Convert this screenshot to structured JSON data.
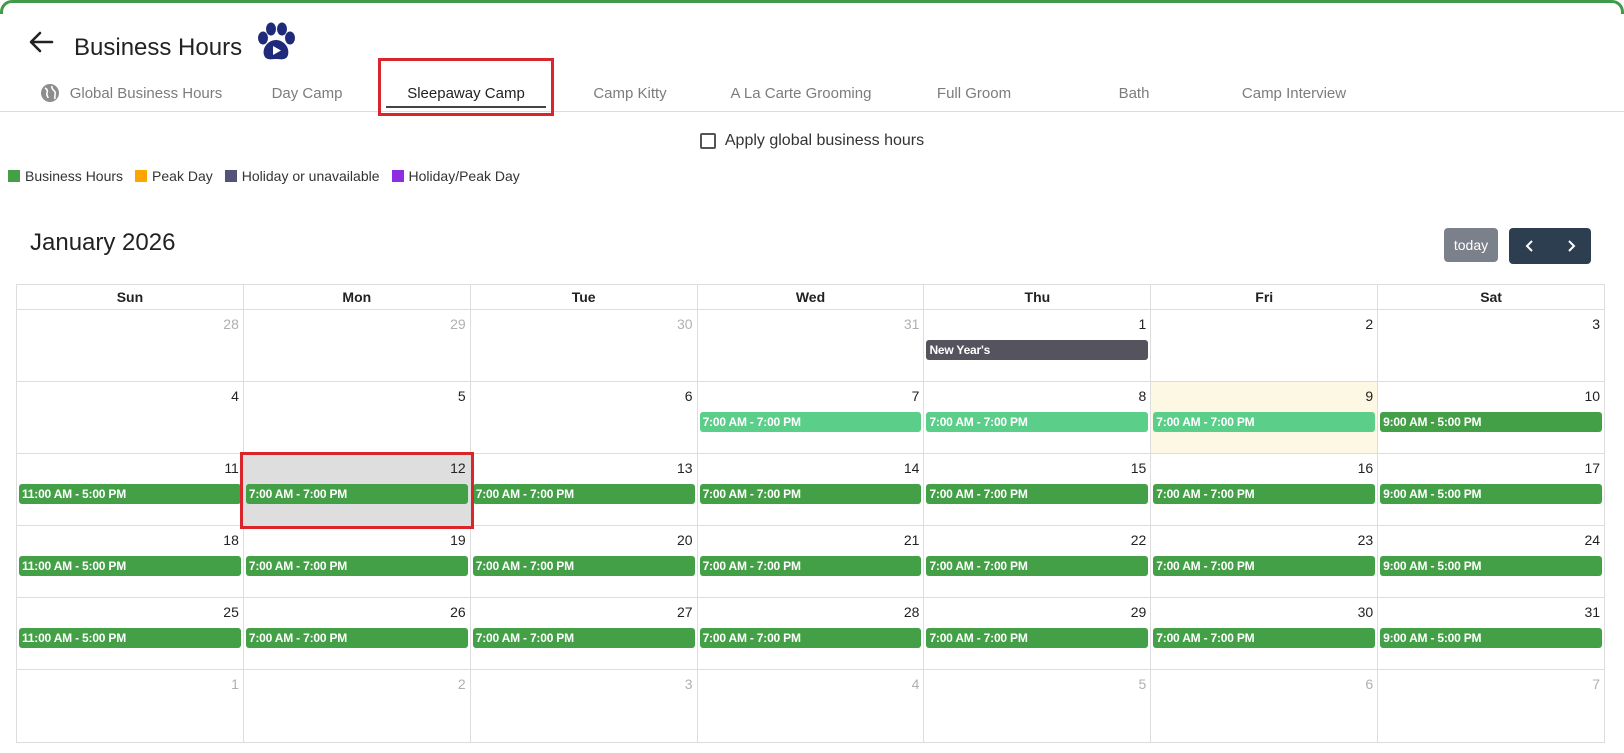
{
  "header": {
    "title": "Business Hours",
    "back_icon": "arrow-left-icon",
    "logo_icon": "paw-play-icon"
  },
  "tabs": [
    {
      "label": "Global Business Hours",
      "icon": "globe-icon"
    },
    {
      "label": "Day Camp"
    },
    {
      "label": "Sleepaway Camp",
      "active": true
    },
    {
      "label": "Camp Kitty"
    },
    {
      "label": "A La Carte Grooming"
    },
    {
      "label": "Full Groom"
    },
    {
      "label": "Bath"
    },
    {
      "label": "Camp Interview"
    }
  ],
  "apply_global": {
    "label": "Apply global business hours",
    "checked": false
  },
  "legend": [
    {
      "label": "Business Hours",
      "color": "#43a047"
    },
    {
      "label": "Peak Day",
      "color": "#ffa500"
    },
    {
      "label": "Holiday or unavailable",
      "color": "#52527a"
    },
    {
      "label": "Holiday/Peak Day",
      "color": "#8e2de2"
    }
  ],
  "calendar": {
    "title": "January 2026",
    "today_label": "today",
    "weekdays": [
      "Sun",
      "Mon",
      "Tue",
      "Wed",
      "Thu",
      "Fri",
      "Sat"
    ],
    "colors": {
      "business": "#43a047",
      "light": "#5bce8a",
      "holiday": "#55535e"
    },
    "weeks": [
      [
        {
          "day": "28",
          "other": true
        },
        {
          "day": "29",
          "other": true
        },
        {
          "day": "30",
          "other": true
        },
        {
          "day": "31",
          "other": true
        },
        {
          "day": "1",
          "event": "New Year's",
          "style": "holiday"
        },
        {
          "day": "2"
        },
        {
          "day": "3"
        }
      ],
      [
        {
          "day": "4"
        },
        {
          "day": "5"
        },
        {
          "day": "6"
        },
        {
          "day": "7",
          "event": "7:00 AM - 7:00 PM",
          "style": "light"
        },
        {
          "day": "8",
          "event": "7:00 AM - 7:00 PM",
          "style": "light"
        },
        {
          "day": "9",
          "event": "7:00 AM - 7:00 PM",
          "style": "light",
          "today": true
        },
        {
          "day": "10",
          "event": "9:00 AM - 5:00 PM",
          "style": "business"
        }
      ],
      [
        {
          "day": "11",
          "event": "11:00 AM - 5:00 PM",
          "style": "business"
        },
        {
          "day": "12",
          "event": "7:00 AM - 7:00 PM",
          "style": "business",
          "selected": true
        },
        {
          "day": "13",
          "event": "7:00 AM - 7:00 PM",
          "style": "business"
        },
        {
          "day": "14",
          "event": "7:00 AM - 7:00 PM",
          "style": "business"
        },
        {
          "day": "15",
          "event": "7:00 AM - 7:00 PM",
          "style": "business"
        },
        {
          "day": "16",
          "event": "7:00 AM - 7:00 PM",
          "style": "business"
        },
        {
          "day": "17",
          "event": "9:00 AM - 5:00 PM",
          "style": "business"
        }
      ],
      [
        {
          "day": "18",
          "event": "11:00 AM - 5:00 PM",
          "style": "business"
        },
        {
          "day": "19",
          "event": "7:00 AM - 7:00 PM",
          "style": "business"
        },
        {
          "day": "20",
          "event": "7:00 AM - 7:00 PM",
          "style": "business"
        },
        {
          "day": "21",
          "event": "7:00 AM - 7:00 PM",
          "style": "business"
        },
        {
          "day": "22",
          "event": "7:00 AM - 7:00 PM",
          "style": "business"
        },
        {
          "day": "23",
          "event": "7:00 AM - 7:00 PM",
          "style": "business"
        },
        {
          "day": "24",
          "event": "9:00 AM - 5:00 PM",
          "style": "business"
        }
      ],
      [
        {
          "day": "25",
          "event": "11:00 AM - 5:00 PM",
          "style": "business"
        },
        {
          "day": "26",
          "event": "7:00 AM - 7:00 PM",
          "style": "business"
        },
        {
          "day": "27",
          "event": "7:00 AM - 7:00 PM",
          "style": "business"
        },
        {
          "day": "28",
          "event": "7:00 AM - 7:00 PM",
          "style": "business"
        },
        {
          "day": "29",
          "event": "7:00 AM - 7:00 PM",
          "style": "business"
        },
        {
          "day": "30",
          "event": "7:00 AM - 7:00 PM",
          "style": "business"
        },
        {
          "day": "31",
          "event": "9:00 AM - 5:00 PM",
          "style": "business"
        }
      ],
      [
        {
          "day": "1",
          "other": true
        },
        {
          "day": "2",
          "other": true
        },
        {
          "day": "3",
          "other": true
        },
        {
          "day": "4",
          "other": true
        },
        {
          "day": "5",
          "other": true
        },
        {
          "day": "6",
          "other": true
        },
        {
          "day": "7",
          "other": true
        }
      ]
    ]
  }
}
